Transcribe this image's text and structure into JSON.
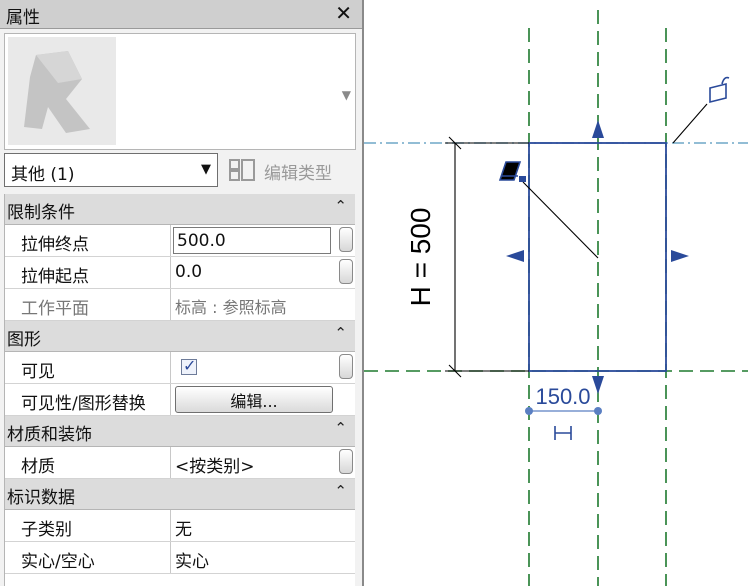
{
  "palette": {
    "title": "属性",
    "type_selector": {
      "value": "其他 (1)"
    },
    "edit_type_label": "编辑类型",
    "groups": [
      {
        "label": "限制条件",
        "props": [
          {
            "name": "拉伸终点",
            "value": "500.0"
          },
          {
            "name": "拉伸起点",
            "value": "0.0"
          },
          {
            "name": "工作平面",
            "value": "标高 : 参照标高"
          }
        ]
      },
      {
        "label": "图形",
        "props": [
          {
            "name": "可见",
            "checked": true
          },
          {
            "name": "可见性/图形替换",
            "button": "编辑..."
          }
        ]
      },
      {
        "label": "材质和装饰",
        "props": [
          {
            "name": "材质",
            "value": "<按类别>"
          }
        ]
      },
      {
        "label": "标识数据",
        "props": [
          {
            "name": "子类别",
            "value": "无"
          },
          {
            "name": "实心/空心",
            "value": "实心"
          }
        ]
      }
    ]
  },
  "canvas": {
    "height_dim": "H = 500",
    "width_dim": "150.0",
    "colors": {
      "ref_plane": "#1e7a2e",
      "level": "#6fa7c7",
      "sketch": "#2a4a9a",
      "dim": "#000000"
    }
  }
}
